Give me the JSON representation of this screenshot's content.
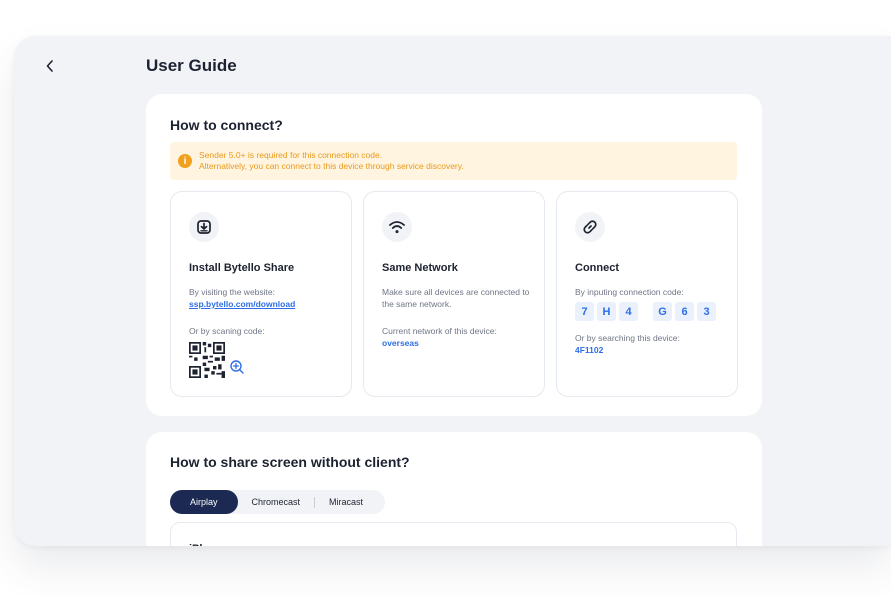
{
  "header": {
    "back_icon": "chevron-left-icon",
    "title": "User Guide"
  },
  "connect": {
    "title": "How to connect?",
    "notice": {
      "icon": "info-icon",
      "line1": "Sender 5.0+ is required for this connection code.",
      "line2": "Alternatively, you can connect to this device through service discovery."
    },
    "cards": [
      {
        "icon": "download-icon",
        "title": "Install Bytello Share",
        "text1": "By visiting the website:",
        "link": "ssp.bytello.com/download",
        "text2": "Or by scaning code:",
        "qr_icon": "qr-code-icon",
        "zoom_icon": "zoom-in-icon"
      },
      {
        "icon": "wifi-icon",
        "title": "Same Network",
        "text1": "Make sure all devices are connected to the same network.",
        "text2": "Current network of this device:",
        "value": "overseas"
      },
      {
        "icon": "link-icon",
        "title": "Connect",
        "text1": "By inputing connection code:",
        "code": [
          "7",
          "H",
          "4",
          "G",
          "6",
          "3"
        ],
        "text2": "Or by searching this device:",
        "value": "4F1102"
      }
    ]
  },
  "share": {
    "title": "How to share screen without client?",
    "tabs": [
      "Airplay",
      "Chromecast",
      "Miracast"
    ],
    "active_tab": "Airplay",
    "device_label": "iPhone"
  },
  "colors": {
    "accent": "#2d6ee6",
    "active_tab": "#1c2a53",
    "notice_bg": "#fff4df",
    "notice_text": "#e99a1c"
  }
}
